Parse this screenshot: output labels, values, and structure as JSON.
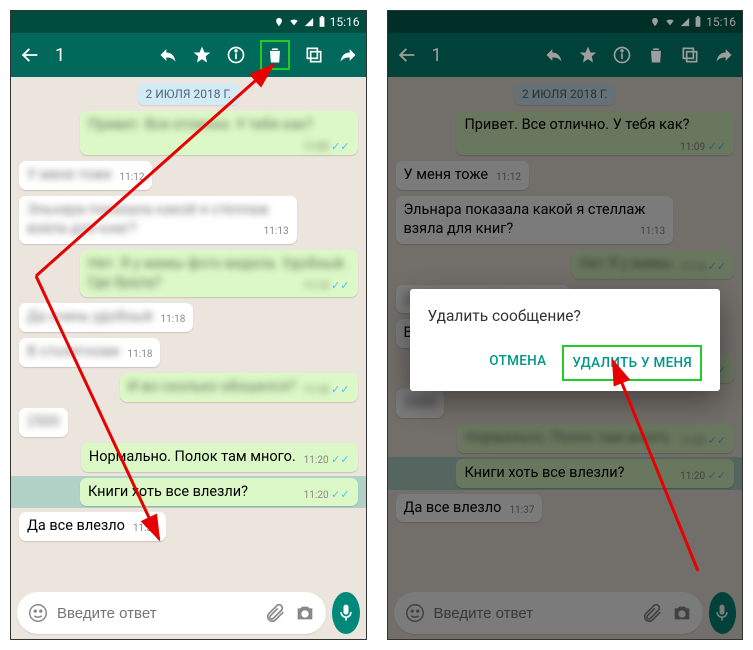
{
  "status": {
    "time": "15:16"
  },
  "appbar": {
    "count": "1"
  },
  "date_chip": "2 ИЮЛЯ 2018 Г.",
  "left": {
    "m1": "Привет. Все отлично. У тебя как?",
    "t1": "11:09",
    "m2": "У меня тоже",
    "t2": "11:12",
    "m3": "Эльнара показала какой я стеллаж взяла для книг?",
    "t3": "11:13",
    "m4": "Нет. Я у мамы фото видела. Удобный. Где брала?",
    "t4": "11:14",
    "m5": "Да очень удобный",
    "t5": "11:18",
    "m6": "В столитхоме",
    "t6": "11:18",
    "m7": "И во сколько обошелся?",
    "t7": "11:18",
    "m8": "2500",
    "t8": "",
    "m9": "Нормально. Полок там много.",
    "t9": "11:20",
    "m10": "Книги хоть все влезли?",
    "t10": "11:20",
    "m11": "Да все влезло",
    "t11": "11:37"
  },
  "right": {
    "m1": "Привет. Все отлично. У тебя как?",
    "t1": "11:09",
    "m2": "У меня тоже",
    "t2": "11:12",
    "m3": "Эльнара показала какой я стеллаж взяла для книг?",
    "t3": "11:13",
    "m4": "Нет  Я у мамы",
    "t4": "11:14",
    "m5": "Да очень удобный",
    "t5": "11:18",
    "m6": "В стоплитхоме",
    "t6": "11:18",
    "m7": "И во сколько обошелся?",
    "t7": "11:18",
    "m8": "2500",
    "t8": "",
    "m9": "Нормально. Полок там много.",
    "t9": "11:20",
    "m10": "Книги хоть все влезли?",
    "t10": "11:20",
    "m11": "Да все влезло",
    "t11": "11:37"
  },
  "input": {
    "placeholder": "Введите ответ"
  },
  "dialog": {
    "title": "Удалить сообщение?",
    "cancel": "ОТМЕНА",
    "delete_for_me": "УДАЛИТЬ У МЕНЯ"
  }
}
